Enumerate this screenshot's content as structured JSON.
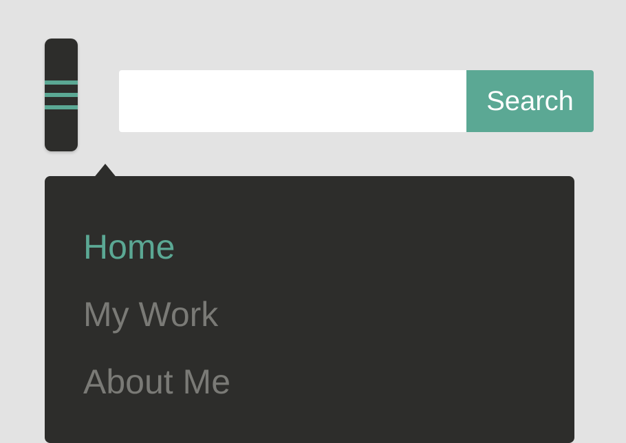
{
  "search": {
    "value": "",
    "placeholder": "",
    "button_label": "Search"
  },
  "menu": {
    "items": [
      {
        "label": "Home",
        "active": true
      },
      {
        "label": "My Work",
        "active": false
      },
      {
        "label": "About Me",
        "active": false
      }
    ]
  },
  "colors": {
    "accent": "#5ba894",
    "panel_dark": "#2d2d2b",
    "background": "#e3e3e3",
    "muted_text": "#7a7a76"
  },
  "icons": {
    "hamburger": "hamburger-icon"
  }
}
